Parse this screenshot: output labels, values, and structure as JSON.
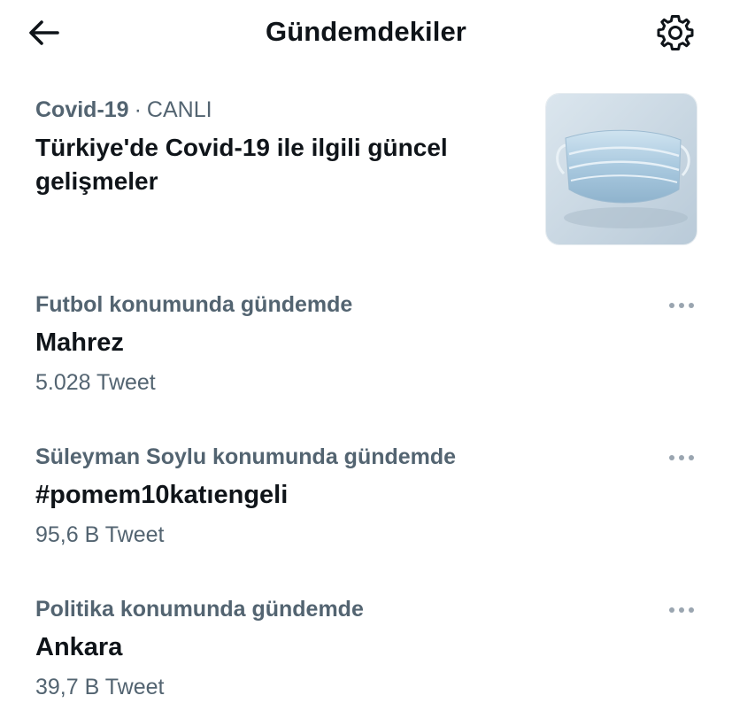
{
  "header": {
    "title": "Gündemdekiler",
    "back_icon": "arrow-left-icon",
    "settings_icon": "gear-icon"
  },
  "featured": {
    "category": "Covid-19",
    "separator": "·",
    "status": "CANLI",
    "headline": "Türkiye'de Covid-19 ile ilgili güncel gelişmeler",
    "thumbnail": "face-mask-image"
  },
  "trends": [
    {
      "context": "Futbol konumunda gündemde",
      "name": "Mahrez",
      "count": "5.028 Tweet",
      "more_icon": "more-dots-icon"
    },
    {
      "context": "Süleyman Soylu konumunda gündemde",
      "name": "#pomem10katıengeli",
      "count": "95,6 B Tweet",
      "more_icon": "more-dots-icon"
    },
    {
      "context": "Politika konumunda gündemde",
      "name": "Ankara",
      "count": "39,7 B Tweet",
      "more_icon": "more-dots-icon"
    }
  ],
  "colors": {
    "text_primary": "#0f1419",
    "text_secondary": "#536471",
    "background": "#ffffff"
  }
}
